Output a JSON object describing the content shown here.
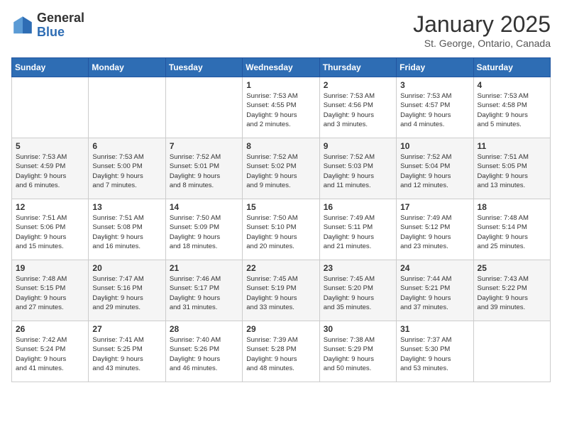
{
  "logo": {
    "general": "General",
    "blue": "Blue"
  },
  "header": {
    "month": "January 2025",
    "location": "St. George, Ontario, Canada"
  },
  "weekdays": [
    "Sunday",
    "Monday",
    "Tuesday",
    "Wednesday",
    "Thursday",
    "Friday",
    "Saturday"
  ],
  "weeks": [
    [
      {
        "day": "",
        "info": ""
      },
      {
        "day": "",
        "info": ""
      },
      {
        "day": "",
        "info": ""
      },
      {
        "day": "1",
        "info": "Sunrise: 7:53 AM\nSunset: 4:55 PM\nDaylight: 9 hours\nand 2 minutes."
      },
      {
        "day": "2",
        "info": "Sunrise: 7:53 AM\nSunset: 4:56 PM\nDaylight: 9 hours\nand 3 minutes."
      },
      {
        "day": "3",
        "info": "Sunrise: 7:53 AM\nSunset: 4:57 PM\nDaylight: 9 hours\nand 4 minutes."
      },
      {
        "day": "4",
        "info": "Sunrise: 7:53 AM\nSunset: 4:58 PM\nDaylight: 9 hours\nand 5 minutes."
      }
    ],
    [
      {
        "day": "5",
        "info": "Sunrise: 7:53 AM\nSunset: 4:59 PM\nDaylight: 9 hours\nand 6 minutes."
      },
      {
        "day": "6",
        "info": "Sunrise: 7:53 AM\nSunset: 5:00 PM\nDaylight: 9 hours\nand 7 minutes."
      },
      {
        "day": "7",
        "info": "Sunrise: 7:52 AM\nSunset: 5:01 PM\nDaylight: 9 hours\nand 8 minutes."
      },
      {
        "day": "8",
        "info": "Sunrise: 7:52 AM\nSunset: 5:02 PM\nDaylight: 9 hours\nand 9 minutes."
      },
      {
        "day": "9",
        "info": "Sunrise: 7:52 AM\nSunset: 5:03 PM\nDaylight: 9 hours\nand 11 minutes."
      },
      {
        "day": "10",
        "info": "Sunrise: 7:52 AM\nSunset: 5:04 PM\nDaylight: 9 hours\nand 12 minutes."
      },
      {
        "day": "11",
        "info": "Sunrise: 7:51 AM\nSunset: 5:05 PM\nDaylight: 9 hours\nand 13 minutes."
      }
    ],
    [
      {
        "day": "12",
        "info": "Sunrise: 7:51 AM\nSunset: 5:06 PM\nDaylight: 9 hours\nand 15 minutes."
      },
      {
        "day": "13",
        "info": "Sunrise: 7:51 AM\nSunset: 5:08 PM\nDaylight: 9 hours\nand 16 minutes."
      },
      {
        "day": "14",
        "info": "Sunrise: 7:50 AM\nSunset: 5:09 PM\nDaylight: 9 hours\nand 18 minutes."
      },
      {
        "day": "15",
        "info": "Sunrise: 7:50 AM\nSunset: 5:10 PM\nDaylight: 9 hours\nand 20 minutes."
      },
      {
        "day": "16",
        "info": "Sunrise: 7:49 AM\nSunset: 5:11 PM\nDaylight: 9 hours\nand 21 minutes."
      },
      {
        "day": "17",
        "info": "Sunrise: 7:49 AM\nSunset: 5:12 PM\nDaylight: 9 hours\nand 23 minutes."
      },
      {
        "day": "18",
        "info": "Sunrise: 7:48 AM\nSunset: 5:14 PM\nDaylight: 9 hours\nand 25 minutes."
      }
    ],
    [
      {
        "day": "19",
        "info": "Sunrise: 7:48 AM\nSunset: 5:15 PM\nDaylight: 9 hours\nand 27 minutes."
      },
      {
        "day": "20",
        "info": "Sunrise: 7:47 AM\nSunset: 5:16 PM\nDaylight: 9 hours\nand 29 minutes."
      },
      {
        "day": "21",
        "info": "Sunrise: 7:46 AM\nSunset: 5:17 PM\nDaylight: 9 hours\nand 31 minutes."
      },
      {
        "day": "22",
        "info": "Sunrise: 7:45 AM\nSunset: 5:19 PM\nDaylight: 9 hours\nand 33 minutes."
      },
      {
        "day": "23",
        "info": "Sunrise: 7:45 AM\nSunset: 5:20 PM\nDaylight: 9 hours\nand 35 minutes."
      },
      {
        "day": "24",
        "info": "Sunrise: 7:44 AM\nSunset: 5:21 PM\nDaylight: 9 hours\nand 37 minutes."
      },
      {
        "day": "25",
        "info": "Sunrise: 7:43 AM\nSunset: 5:22 PM\nDaylight: 9 hours\nand 39 minutes."
      }
    ],
    [
      {
        "day": "26",
        "info": "Sunrise: 7:42 AM\nSunset: 5:24 PM\nDaylight: 9 hours\nand 41 minutes."
      },
      {
        "day": "27",
        "info": "Sunrise: 7:41 AM\nSunset: 5:25 PM\nDaylight: 9 hours\nand 43 minutes."
      },
      {
        "day": "28",
        "info": "Sunrise: 7:40 AM\nSunset: 5:26 PM\nDaylight: 9 hours\nand 46 minutes."
      },
      {
        "day": "29",
        "info": "Sunrise: 7:39 AM\nSunset: 5:28 PM\nDaylight: 9 hours\nand 48 minutes."
      },
      {
        "day": "30",
        "info": "Sunrise: 7:38 AM\nSunset: 5:29 PM\nDaylight: 9 hours\nand 50 minutes."
      },
      {
        "day": "31",
        "info": "Sunrise: 7:37 AM\nSunset: 5:30 PM\nDaylight: 9 hours\nand 53 minutes."
      },
      {
        "day": "",
        "info": ""
      }
    ]
  ]
}
